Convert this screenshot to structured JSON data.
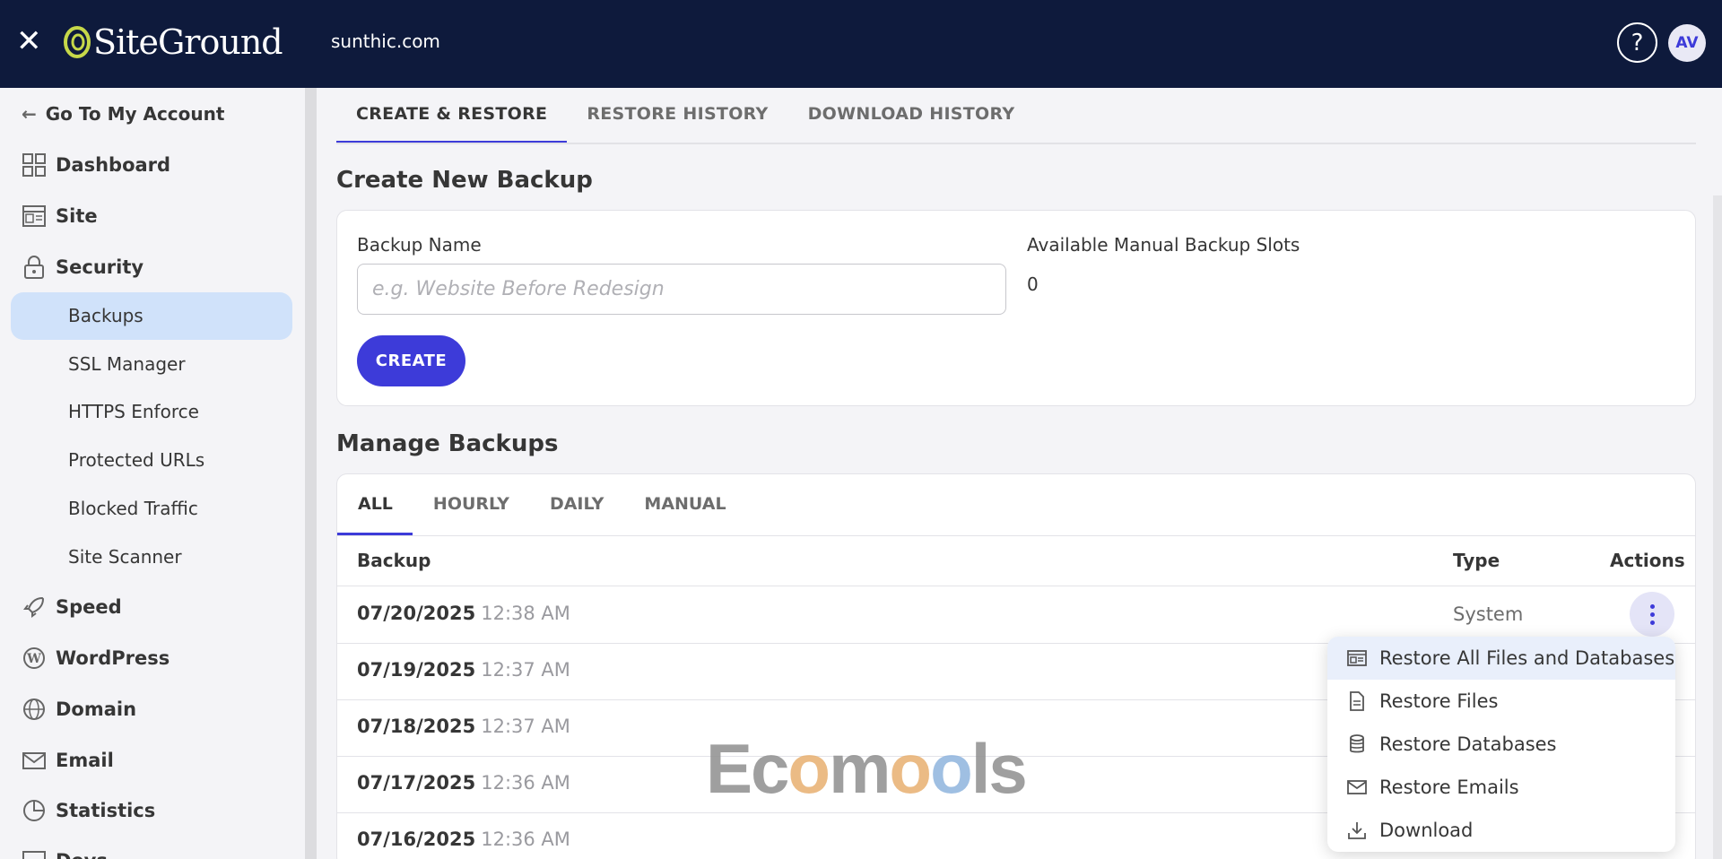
{
  "header": {
    "close_icon": "close-icon",
    "logo_text": "SiteGround",
    "site_domain": "sunthic.com",
    "help_label": "?",
    "avatar_initials": "AV"
  },
  "sidebar": {
    "back_label": "Go To My Account",
    "items": [
      {
        "label": "Dashboard",
        "icon": "grid-icon"
      },
      {
        "label": "Site",
        "icon": "site-icon"
      },
      {
        "label": "Security",
        "icon": "lock-icon"
      },
      {
        "label": "Speed",
        "icon": "rocket-icon"
      },
      {
        "label": "WordPress",
        "icon": "wordpress-icon"
      },
      {
        "label": "Domain",
        "icon": "globe-icon"
      },
      {
        "label": "Email",
        "icon": "mail-icon"
      },
      {
        "label": "Statistics",
        "icon": "pie-icon"
      },
      {
        "label": "Devs",
        "icon": "code-icon"
      }
    ],
    "security_sub": [
      "Backups",
      "SSL Manager",
      "HTTPS Enforce",
      "Protected URLs",
      "Blocked Traffic",
      "Site Scanner"
    ],
    "active_sub": "Backups"
  },
  "tabs": [
    "CREATE & RESTORE",
    "RESTORE HISTORY",
    "DOWNLOAD HISTORY"
  ],
  "create": {
    "title": "Create New Backup",
    "name_label": "Backup Name",
    "name_placeholder": "e.g. Website Before Redesign",
    "slots_label": "Available Manual Backup Slots",
    "slots_value": "0",
    "create_label": "CREATE"
  },
  "manage": {
    "title": "Manage Backups",
    "filters": [
      "ALL",
      "HOURLY",
      "DAILY",
      "MANUAL"
    ],
    "columns": {
      "backup": "Backup",
      "type": "Type",
      "actions": "Actions"
    },
    "rows": [
      {
        "date": "07/20/2025",
        "time": "12:38 AM",
        "type": "System"
      },
      {
        "date": "07/19/2025",
        "time": "12:37 AM",
        "type": ""
      },
      {
        "date": "07/18/2025",
        "time": "12:37 AM",
        "type": ""
      },
      {
        "date": "07/17/2025",
        "time": "12:36 AM",
        "type": ""
      },
      {
        "date": "07/16/2025",
        "time": "12:36 AM",
        "type": ""
      }
    ]
  },
  "actions_menu": [
    {
      "label": "Restore All Files and Databases",
      "icon": "restore-all-icon"
    },
    {
      "label": "Restore Files",
      "icon": "file-icon"
    },
    {
      "label": "Restore Databases",
      "icon": "database-icon"
    },
    {
      "label": "Restore Emails",
      "icon": "mail-icon"
    },
    {
      "label": "Download",
      "icon": "download-icon"
    }
  ],
  "watermark": "Ecomools",
  "colors": {
    "accent": "#3d3bd9",
    "header_bg": "#0e1a3c",
    "active_nav_bg": "#d0e2fa"
  }
}
